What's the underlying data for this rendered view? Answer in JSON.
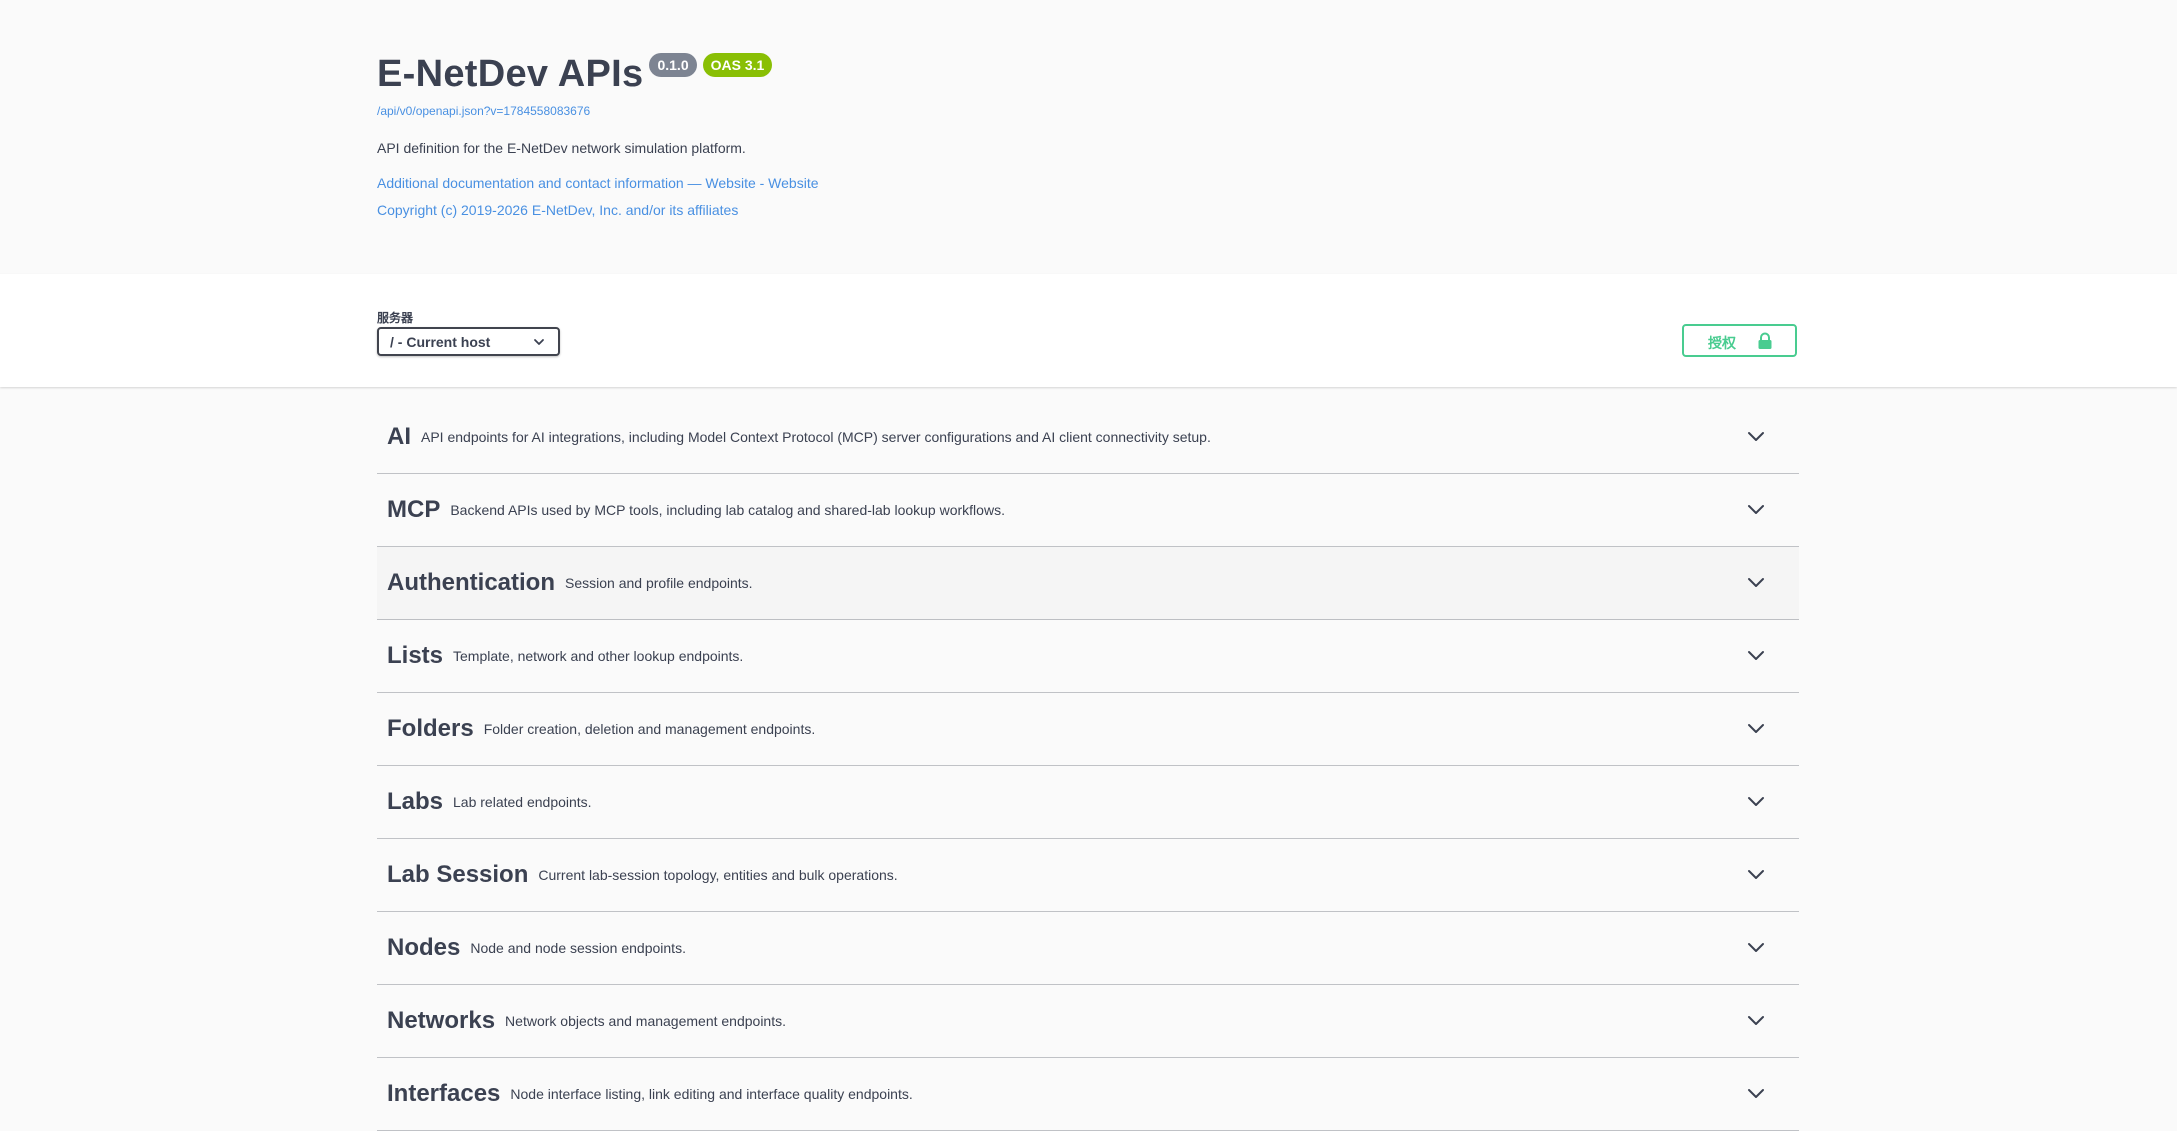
{
  "info": {
    "title": "E-NetDev APIs",
    "version_badge": "0.1.0",
    "oas_badge": "OAS 3.1",
    "spec_url": "/api/v0/openapi.json?v=1784558083676",
    "description": "API definition for the E-NetDev network simulation platform.",
    "links": [
      "Additional documentation and contact information — Website - Website",
      "Copyright (c) 2019-2026 E-NetDev, Inc. and/or its affiliates"
    ]
  },
  "servers": {
    "label": "服务器",
    "selected": "/ - Current host"
  },
  "authorize": {
    "label": "授权"
  },
  "tags": [
    {
      "name": "AI",
      "description": "API endpoints for AI integrations, including Model Context Protocol (MCP) server configurations and AI client connectivity setup."
    },
    {
      "name": "MCP",
      "description": "Backend APIs used by MCP tools, including lab catalog and shared-lab lookup workflows."
    },
    {
      "name": "Authentication",
      "description": "Session and profile endpoints."
    },
    {
      "name": "Lists",
      "description": "Template, network and other lookup endpoints."
    },
    {
      "name": "Folders",
      "description": "Folder creation, deletion and management endpoints."
    },
    {
      "name": "Labs",
      "description": "Lab related endpoints."
    },
    {
      "name": "Lab Session",
      "description": "Current lab-session topology, entities and bulk operations."
    },
    {
      "name": "Nodes",
      "description": "Node and node session endpoints."
    },
    {
      "name": "Networks",
      "description": "Network objects and management endpoints."
    },
    {
      "name": "Interfaces",
      "description": "Node interface listing, link editing and interface quality endpoints."
    }
  ],
  "colors": {
    "link": "#4990e2",
    "authorize": "#49cc90",
    "version_badge": "#7d8492",
    "oas_badge": "#89bf04",
    "text": "#3b4151"
  },
  "icons": {
    "server_dropdown": "chevron-down-icon",
    "authorize": "lock-icon",
    "tag_expand": "chevron-down-icon"
  }
}
